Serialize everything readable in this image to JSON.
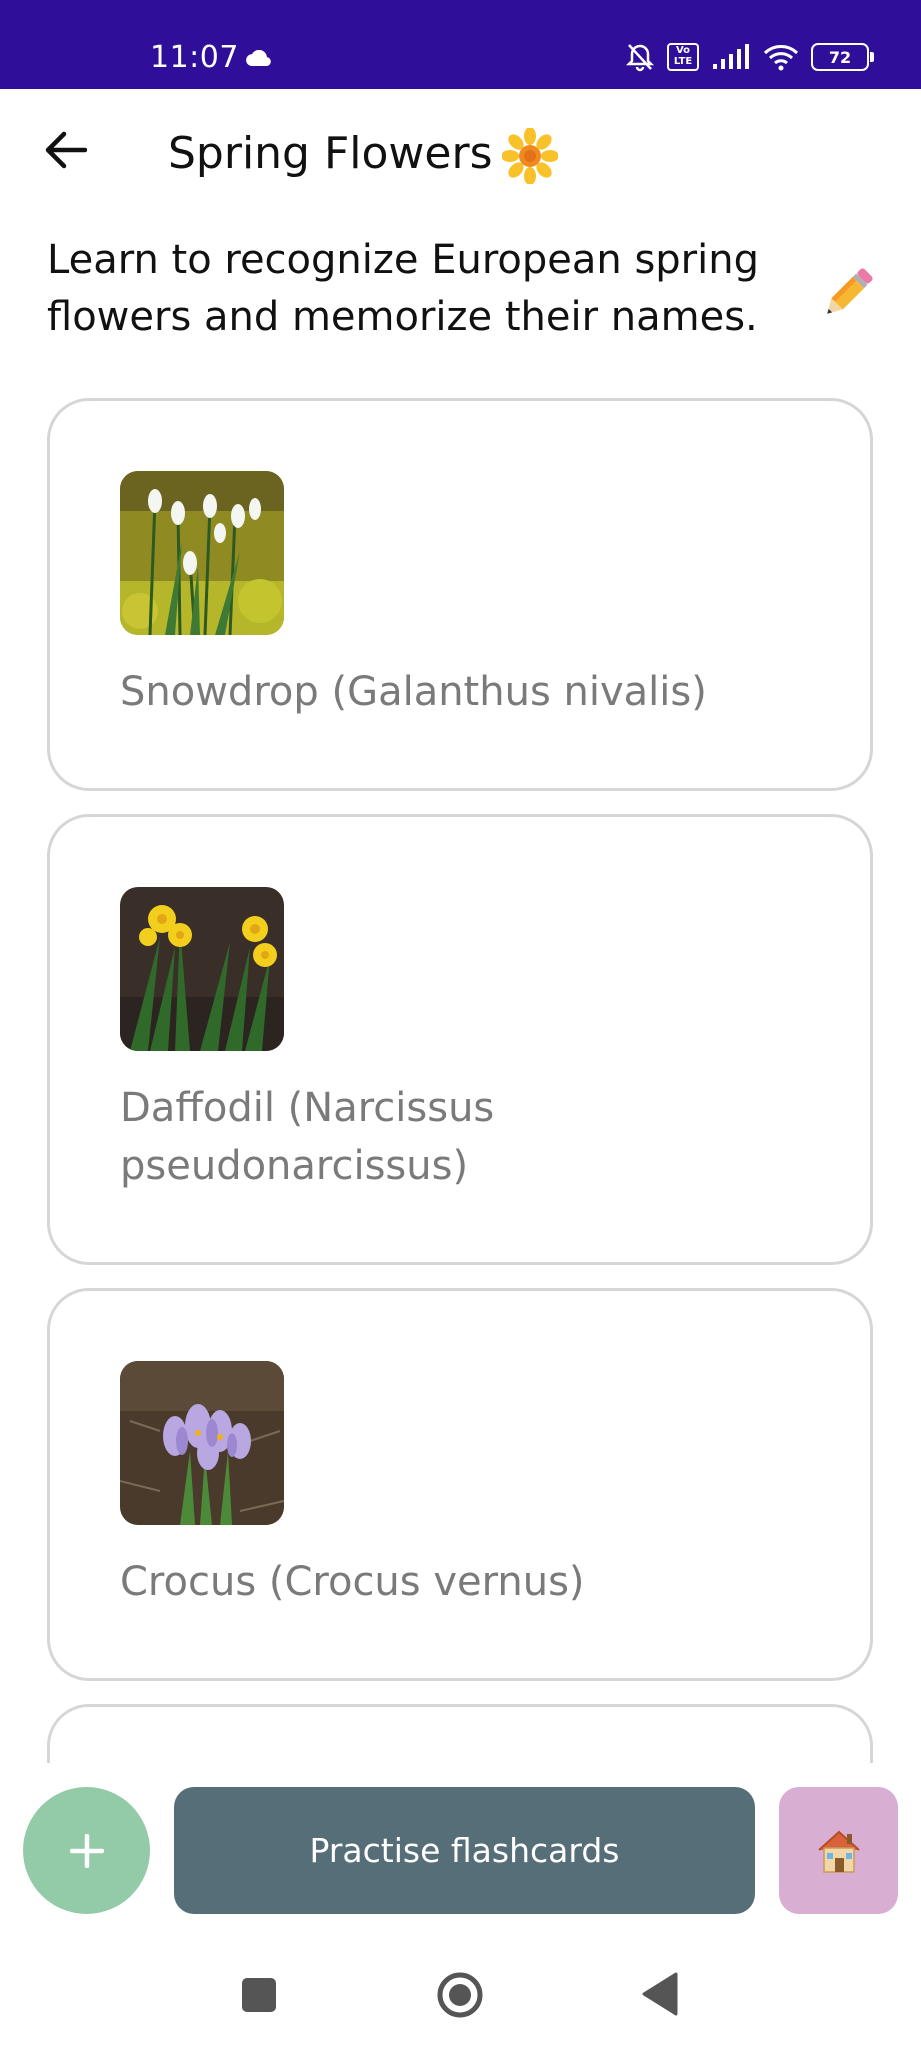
{
  "status_bar": {
    "time": "11:07",
    "battery": "72",
    "volte_label": "Vo LTE",
    "wifi_sub": "6"
  },
  "header": {
    "title": "Spring Flowers"
  },
  "description": "Learn to recognize European spring flowers and memorize their names.",
  "cards": [
    {
      "label": "Snowdrop (Galanthus nivalis)"
    },
    {
      "label": "Daffodil (Narcissus pseudonarcissus)"
    },
    {
      "label": "Crocus (Crocus vernus)"
    }
  ],
  "actions": {
    "add_label": "+",
    "practise_label": "Practise flashcards"
  },
  "colors": {
    "status_bar": "#2f0f99",
    "fab_add": "#93cba9",
    "practise_button": "#566e78",
    "home_button": "#d8afd2",
    "card_text": "#7a7a7a"
  },
  "icons": {
    "back": "arrow-left-icon",
    "title_emoji": "sunflower-icon",
    "edit": "pencil-icon",
    "home": "house-icon",
    "nav": [
      "square-icon",
      "circle-icon",
      "triangle-back-icon"
    ]
  }
}
